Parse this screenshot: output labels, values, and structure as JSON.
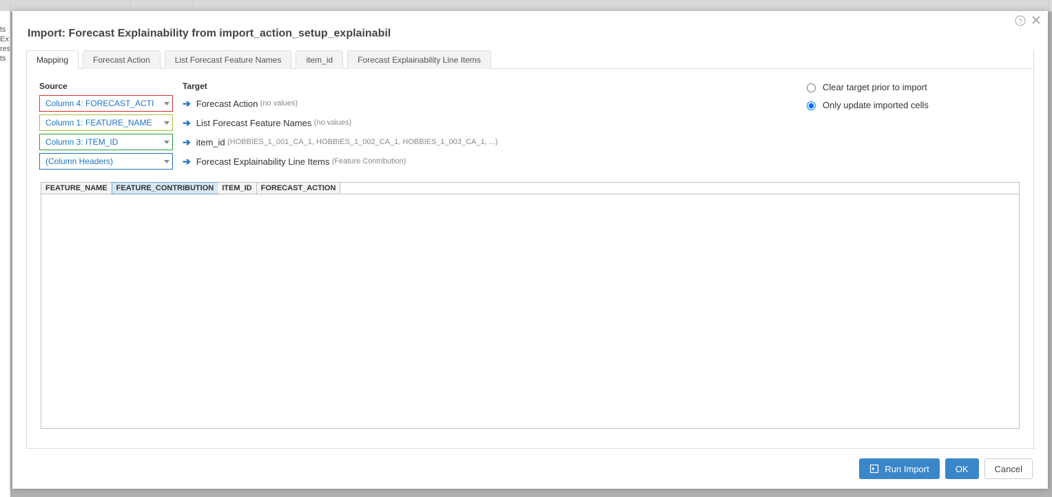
{
  "modal": {
    "title": "Import: Forecast Explainability from import_action_setup_explainabil"
  },
  "tabs": {
    "items": [
      {
        "label": "Mapping",
        "active": true
      },
      {
        "label": "Forecast Action",
        "active": false
      },
      {
        "label": "List Forecast Feature Names",
        "active": false
      },
      {
        "label": "item_id",
        "active": false
      },
      {
        "label": "Forecast Explainability Line Items",
        "active": false
      }
    ]
  },
  "headers": {
    "source": "Source",
    "target": "Target"
  },
  "mappings": [
    {
      "source": "Column 4: FORECAST_ACTI",
      "target": "Forecast Action",
      "hint": "(no values)",
      "border": "bd-red"
    },
    {
      "source": "Column 1: FEATURE_NAME",
      "target": "List Forecast Feature Names",
      "hint": "(no values)",
      "border": "bd-yellow"
    },
    {
      "source": "Column 3: ITEM_ID",
      "target": "item_id",
      "hint": "(HOBBIES_1_001_CA_1, HOBBIES_1_002_CA_1, HOBBIES_1_003_CA_1, ...)",
      "border": "bd-green"
    },
    {
      "source": "(Column Headers)",
      "target": "Forecast Explainability Line Items",
      "hint": "(Feature Contribution)",
      "border": "bd-blue"
    }
  ],
  "options": {
    "clear": "Clear target prior to import",
    "update": "Only update imported cells",
    "selected": "update"
  },
  "preview_columns": [
    {
      "label": "FEATURE_NAME",
      "selected": false
    },
    {
      "label": "FEATURE_CONTRIBUTION",
      "selected": true
    },
    {
      "label": "ITEM_ID",
      "selected": false
    },
    {
      "label": "FORECAST_ACTION",
      "selected": false
    }
  ],
  "buttons": {
    "run": "Run Import",
    "ok": "OK",
    "cancel": "Cancel"
  },
  "back_side_text": "ts\nEx\nres\nts"
}
